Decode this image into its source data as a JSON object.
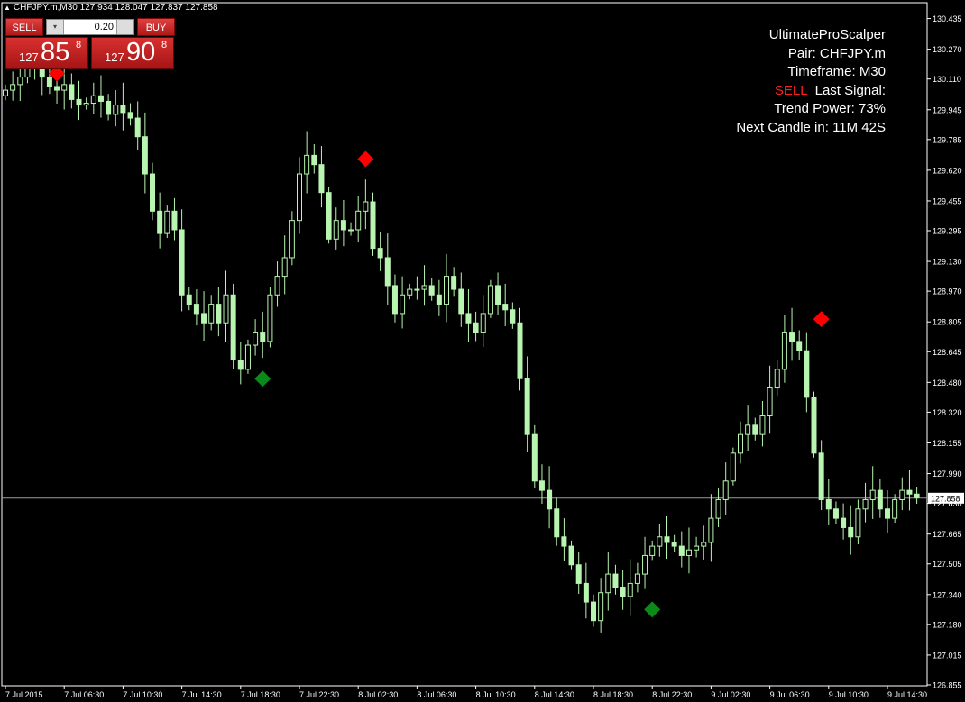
{
  "window": {
    "title": "CHFJPY.m,M30  127.934 128.047 127.837 127.858"
  },
  "trade_panel": {
    "sell_label": "SELL",
    "buy_label": "BUY",
    "lot_value": "0.20",
    "sell_price_prefix": "127",
    "sell_price_big": "85",
    "sell_price_sup": "8",
    "buy_price_prefix": "127",
    "buy_price_big": "90",
    "buy_price_sup": "8"
  },
  "info": {
    "name": "UltimateProScalper",
    "pair": "Pair: CHFJPY.m",
    "timeframe": "Timeframe: M30",
    "signal_value": "SELL",
    "signal_label": "Last Signal:",
    "trend_power": "Trend Power: 73%",
    "next_candle": "Next Candle in: 11M 42S"
  },
  "colors": {
    "background": "#000000",
    "candle": "#b8f5b0",
    "axis": "#ffffff",
    "sell_signal": "#ff0000",
    "buy_signal": "#0b8a1a",
    "price_line": "#9a9a9a"
  },
  "chart_data": {
    "type": "candlestick",
    "symbol": "CHFJPY.m",
    "timeframe": "M30",
    "ylim": [
      126.85,
      130.52
    ],
    "current_price": 127.858,
    "current_price_label": "127.858",
    "y_ticks": [
      "130.435",
      "130.270",
      "130.110",
      "129.945",
      "129.785",
      "129.620",
      "129.455",
      "129.295",
      "129.130",
      "128.970",
      "128.805",
      "128.645",
      "128.480",
      "128.320",
      "128.155",
      "127.990",
      "127.830",
      "127.665",
      "127.505",
      "127.340",
      "127.180",
      "127.015",
      "126.855"
    ],
    "x_ticks": [
      "7 Jul 2015",
      "7 Jul 06:30",
      "7 Jul 10:30",
      "7 Jul 14:30",
      "7 Jul 18:30",
      "7 Jul 22:30",
      "8 Jul 02:30",
      "8 Jul 06:30",
      "8 Jul 10:30",
      "8 Jul 14:30",
      "8 Jul 18:30",
      "8 Jul 22:30",
      "9 Jul 02:30",
      "9 Jul 06:30",
      "9 Jul 10:30",
      "9 Jul 14:30"
    ],
    "x_tick_index": [
      0,
      8,
      16,
      24,
      32,
      40,
      48,
      56,
      64,
      72,
      80,
      88,
      96,
      104,
      112,
      120
    ],
    "close": [
      130.05,
      130.08,
      130.12,
      130.18,
      130.17,
      130.12,
      130.07,
      130.05,
      130.08,
      130.0,
      129.97,
      129.98,
      130.02,
      129.99,
      129.92,
      129.97,
      129.93,
      129.9,
      129.8,
      129.6,
      129.4,
      129.28,
      129.4,
      129.3,
      128.95,
      128.9,
      128.85,
      128.8,
      128.9,
      128.8,
      128.95,
      128.6,
      128.55,
      128.68,
      128.75,
      128.7,
      128.95,
      129.05,
      129.15,
      129.35,
      129.6,
      129.7,
      129.65,
      129.5,
      129.25,
      129.35,
      129.3,
      129.3,
      129.4,
      129.45,
      129.2,
      129.15,
      129.0,
      128.85,
      128.95,
      128.98,
      128.98,
      129.0,
      128.95,
      128.9,
      129.05,
      128.98,
      128.85,
      128.8,
      128.75,
      128.85,
      129.0,
      128.9,
      128.87,
      128.8,
      128.5,
      128.2,
      127.95,
      127.9,
      127.8,
      127.65,
      127.6,
      127.5,
      127.4,
      127.3,
      127.2,
      127.35,
      127.45,
      127.38,
      127.33,
      127.4,
      127.45,
      127.55,
      127.6,
      127.65,
      127.62,
      127.6,
      127.55,
      127.58,
      127.6,
      127.62,
      127.75,
      127.85,
      127.95,
      128.1,
      128.2,
      128.25,
      128.2,
      128.3,
      128.45,
      128.55,
      128.75,
      128.7,
      128.65,
      128.4,
      128.1,
      127.85,
      127.8,
      127.75,
      127.7,
      127.65,
      127.8,
      127.85,
      127.9,
      127.8,
      127.75,
      127.85,
      127.9,
      127.88,
      127.86
    ],
    "signals": [
      {
        "type": "sell",
        "index": 7,
        "price": 130.14
      },
      {
        "type": "sell",
        "index": 49,
        "price": 129.68
      },
      {
        "type": "sell",
        "index": 111,
        "price": 128.82
      },
      {
        "type": "buy",
        "index": 35,
        "price": 128.5
      },
      {
        "type": "buy",
        "index": 88,
        "price": 127.26
      }
    ]
  }
}
